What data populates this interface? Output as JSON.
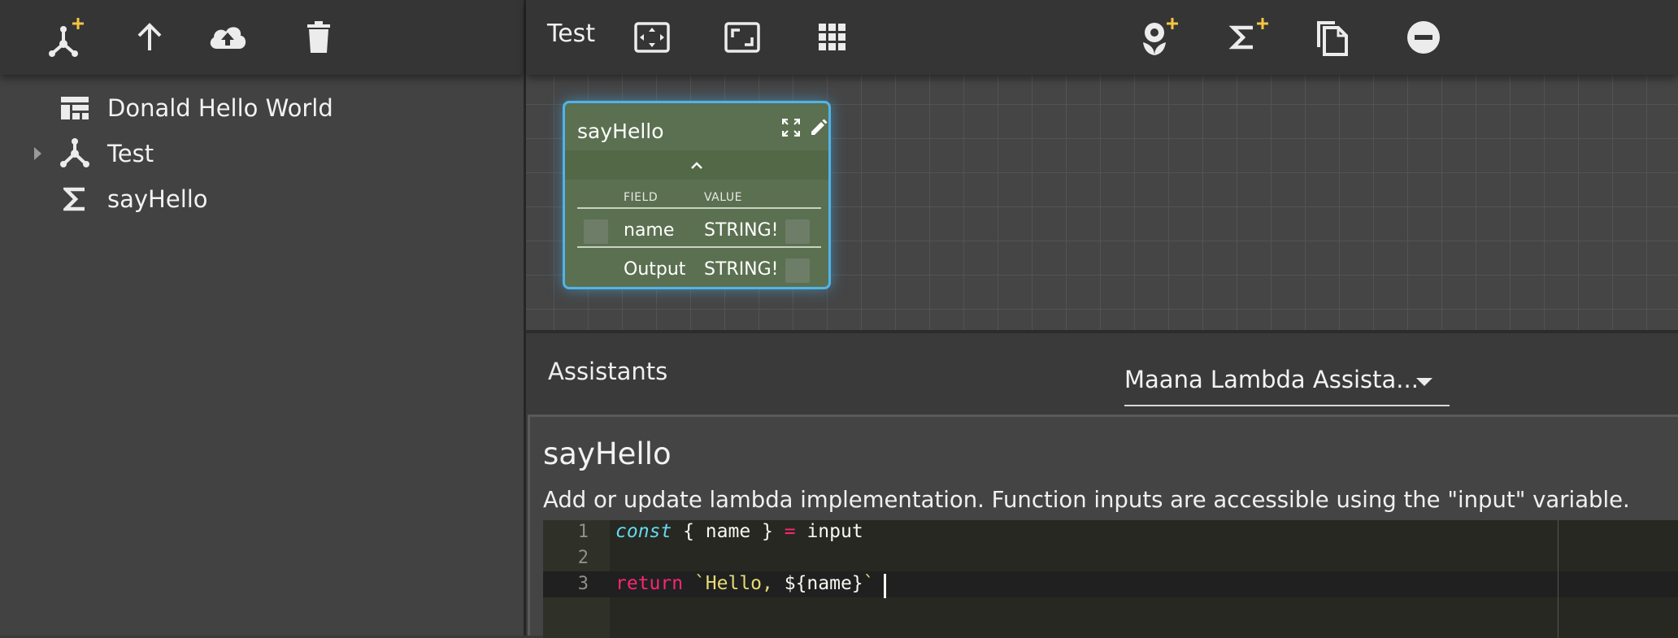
{
  "sidebar": {
    "toolbar": {
      "add_graph_label": "Add graph",
      "move_up_label": "Move up",
      "upload_label": "Upload",
      "delete_label": "Delete"
    },
    "items": [
      {
        "label": "Donald Hello World",
        "icon": "dashboard-icon"
      },
      {
        "label": "Test",
        "icon": "graph-icon",
        "expandable": true
      },
      {
        "label": "sayHello",
        "icon": "sigma-icon"
      }
    ]
  },
  "header": {
    "title": "Test",
    "tools": [
      "fit-to-screen-icon",
      "fullscreen-icon",
      "grid-icon",
      "add-service-icon",
      "add-function-icon",
      "copy-icon",
      "remove-icon"
    ]
  },
  "node": {
    "title": "sayHello",
    "columns": {
      "field": "FIELD",
      "value": "VALUE"
    },
    "rows": [
      {
        "field": "name",
        "value": "STRING!"
      },
      {
        "field": "Output",
        "value": "STRING!"
      }
    ]
  },
  "assistants": {
    "label": "Assistants",
    "selected": "Maana Lambda Assista..."
  },
  "editor": {
    "title": "sayHello",
    "description": "Add or update lambda implementation. Function inputs are accessible using the \"input\" variable.",
    "lines": [
      {
        "num": "1",
        "text": "const { name } = input"
      },
      {
        "num": "2",
        "text": ""
      },
      {
        "num": "3",
        "text": "return `Hello, ${name}`"
      }
    ],
    "tokens": {
      "l1_kw": "const",
      "l1_rest": " { name } ",
      "l1_op": "=",
      "l1_tail": " input",
      "l3_kw": "return",
      "l3_str": " `Hello, ",
      "l3_tpl": "${name}",
      "l3_end": "`"
    }
  },
  "colors": {
    "accent_yellow": "#f5c542",
    "node_border": "#4fb4ea",
    "node_fill": "#5b7050"
  }
}
